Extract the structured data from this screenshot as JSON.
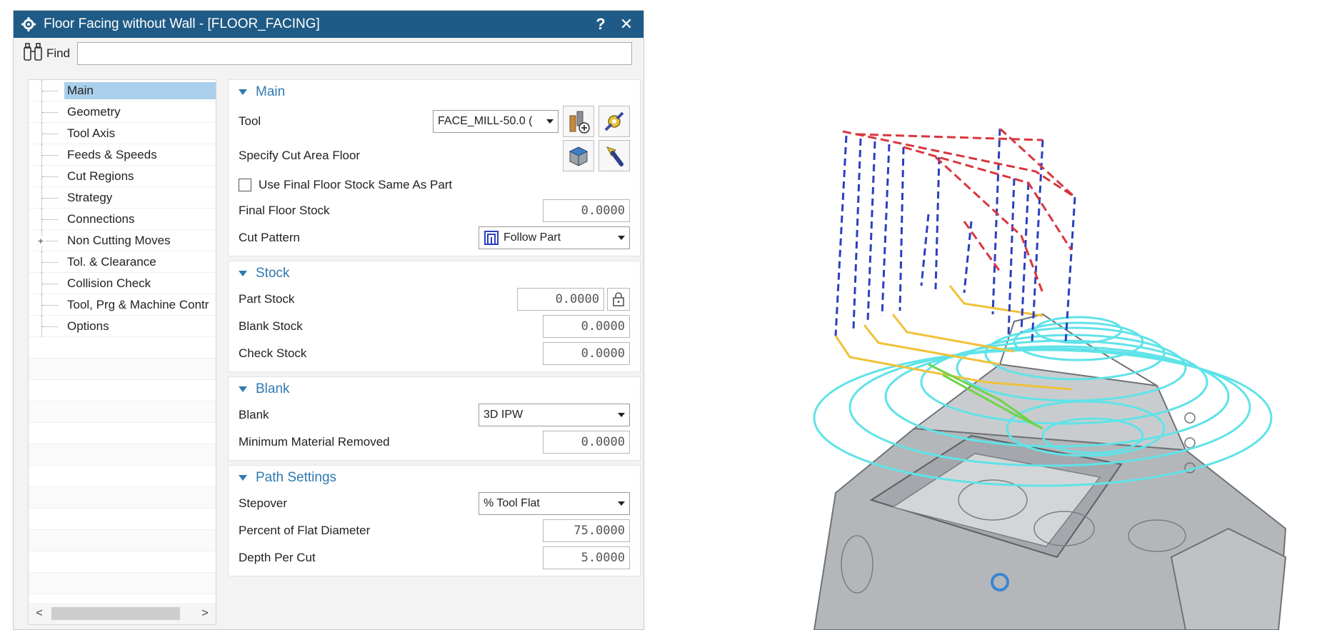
{
  "dialog": {
    "title": "Floor Facing without Wall - [FLOOR_FACING]",
    "help_label": "?",
    "close_label": "✕"
  },
  "find": {
    "label": "Find",
    "value": "",
    "placeholder": ""
  },
  "tree": {
    "items": [
      {
        "label": "Main",
        "selected": true
      },
      {
        "label": "Geometry"
      },
      {
        "label": "Tool Axis"
      },
      {
        "label": "Feeds & Speeds"
      },
      {
        "label": "Cut Regions"
      },
      {
        "label": "Strategy"
      },
      {
        "label": "Connections"
      },
      {
        "label": "Non Cutting Moves",
        "expandable": true
      },
      {
        "label": "Tol. & Clearance"
      },
      {
        "label": "Collision Check"
      },
      {
        "label": "Tool, Prg & Machine Contr"
      },
      {
        "label": "Options"
      }
    ],
    "scroll_left": "<",
    "scroll_right": ">"
  },
  "main": {
    "header": "Main",
    "tool_label": "Tool",
    "tool_value": "FACE_MILL-50.0 (",
    "cut_area_label": "Specify Cut Area Floor",
    "checkbox_label": "Use Final Floor Stock Same As Part",
    "final_floor_label": "Final Floor Stock",
    "final_floor_value": "0.0000",
    "cut_pattern_label": "Cut Pattern",
    "cut_pattern_value": "Follow Part"
  },
  "stock": {
    "header": "Stock",
    "part_label": "Part Stock",
    "part_value": "0.0000",
    "blank_label": "Blank Stock",
    "blank_value": "0.0000",
    "check_label": "Check Stock",
    "check_value": "0.0000"
  },
  "blank": {
    "header": "Blank",
    "blank_label": "Blank",
    "blank_value": "3D IPW",
    "min_label": "Minimum Material Removed",
    "min_value": "0.0000"
  },
  "path": {
    "header": "Path Settings",
    "stepover_label": "Stepover",
    "stepover_value": "% Tool Flat",
    "percent_label": "Percent of Flat Diameter",
    "percent_value": "75.0000",
    "depth_label": "Depth Per Cut",
    "depth_value": "5.0000"
  },
  "colors": {
    "titlebar": "#1f5b86",
    "section_header": "#2f7ab0",
    "selection": "#a9cfea",
    "toolpath_cyan": "#5fe3e8",
    "toolpath_red": "#d9363e",
    "toolpath_blue": "#2b3fbf",
    "toolpath_yellow": "#f0c13a",
    "toolpath_green": "#6fd34a",
    "part_gray": "#b4b7ba"
  }
}
